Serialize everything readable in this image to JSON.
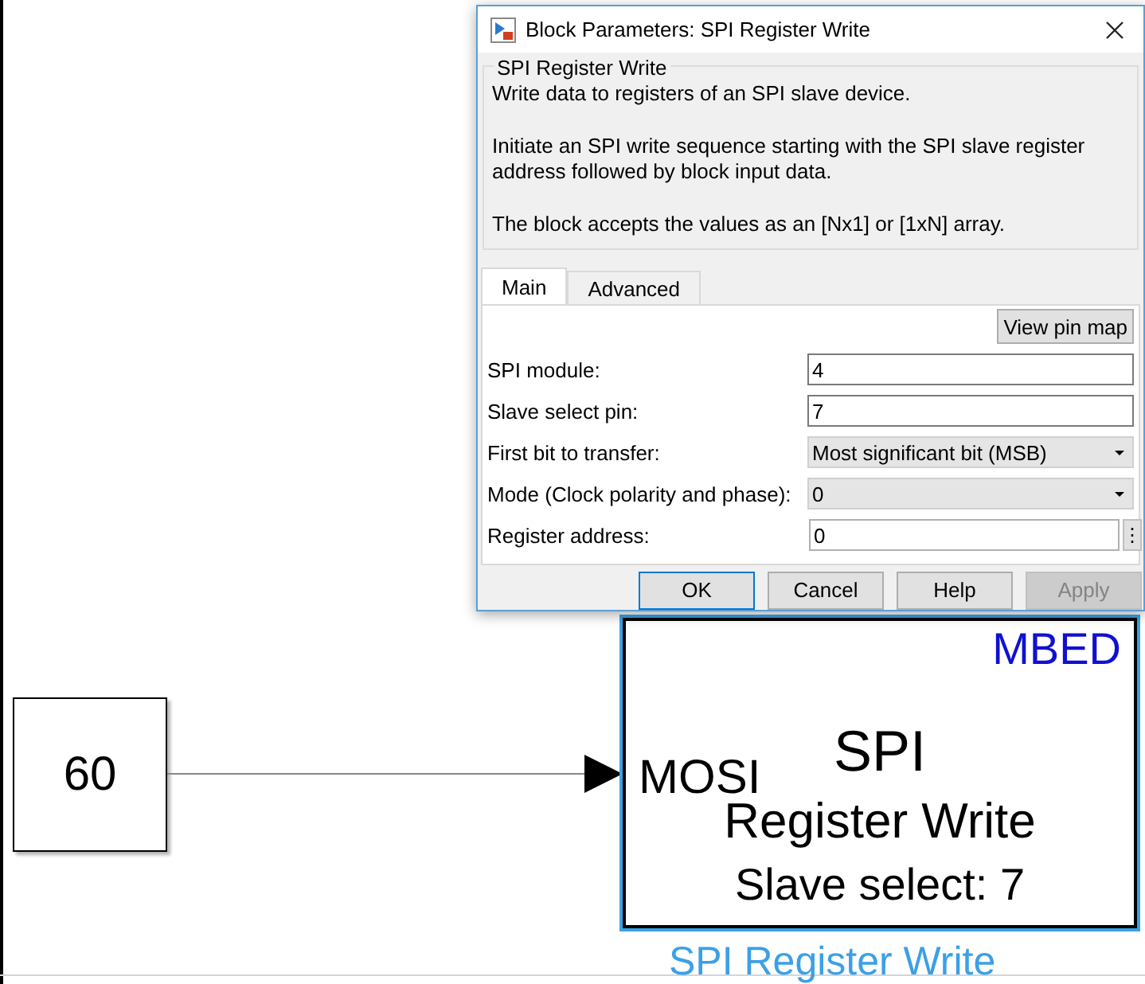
{
  "canvas": {
    "constant_block": {
      "value": "60"
    },
    "spi_block": {
      "selected": true,
      "library": "MBED",
      "title": "SPI",
      "subtitle": "Register Write",
      "detail": "Slave select: 7",
      "input_port": "MOSI",
      "name": "SPI Register Write"
    }
  },
  "dialog": {
    "title": "Block Parameters: SPI Register Write",
    "group_title": "SPI Register Write",
    "description": [
      "Write data to registers of an SPI slave device.",
      "Initiate an SPI write sequence starting with the SPI slave register address followed by block input data.",
      "The block accepts the values as an [Nx1] or [1xN] array."
    ],
    "tabs": [
      {
        "label": "Main",
        "selected": true
      },
      {
        "label": "Advanced",
        "selected": false
      }
    ],
    "pin_map_button": "View pin map",
    "params": [
      {
        "kind": "edit",
        "label": "SPI module:",
        "value": "4"
      },
      {
        "kind": "edit",
        "label": "Slave select pin:",
        "value": "7"
      },
      {
        "kind": "popup",
        "label": "First bit to transfer:",
        "value": "Most significant bit (MSB)"
      },
      {
        "kind": "popup",
        "label": "Mode (Clock polarity and phase):",
        "value": "0"
      },
      {
        "kind": "edit_more",
        "label": "Register address:",
        "value": "0",
        "more": "⋮"
      }
    ],
    "buttons": [
      {
        "label": "OK",
        "default": true,
        "disabled": false
      },
      {
        "label": "Cancel",
        "default": false,
        "disabled": false
      },
      {
        "label": "Help",
        "default": false,
        "disabled": false
      },
      {
        "label": "Apply",
        "default": false,
        "disabled": true
      }
    ]
  }
}
